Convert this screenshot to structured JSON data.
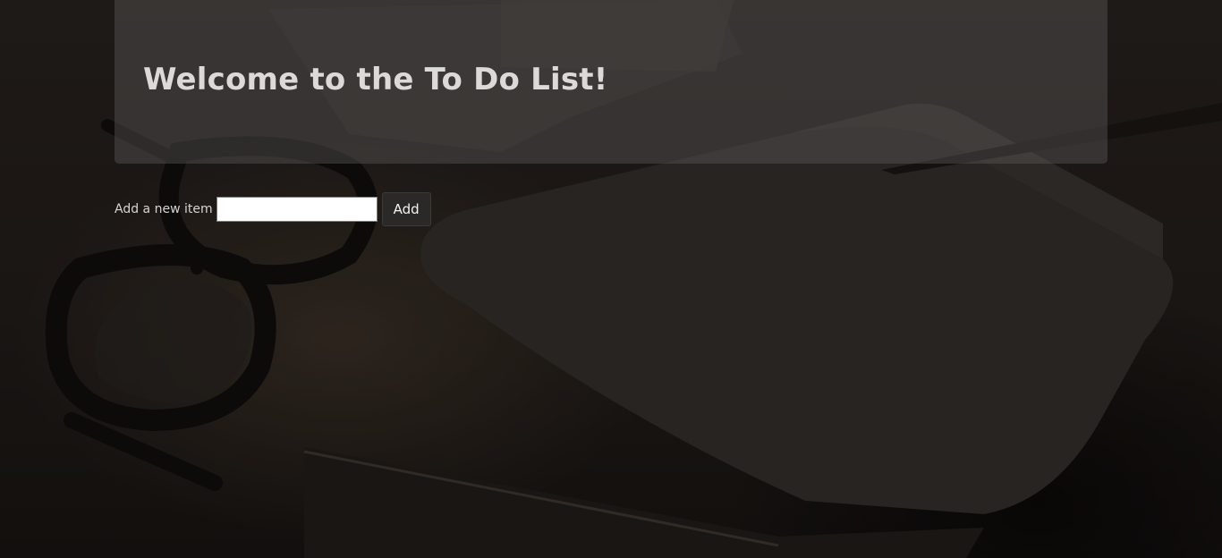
{
  "header": {
    "title": "Welcome to the To Do List!"
  },
  "add_item": {
    "label": "Add a new item",
    "input_value": "",
    "input_placeholder": "",
    "button_label": "Add"
  },
  "theme": {
    "panel_color": "#5c5a5a",
    "button_color": "#2b2928",
    "text_color": "#dcdad8"
  }
}
